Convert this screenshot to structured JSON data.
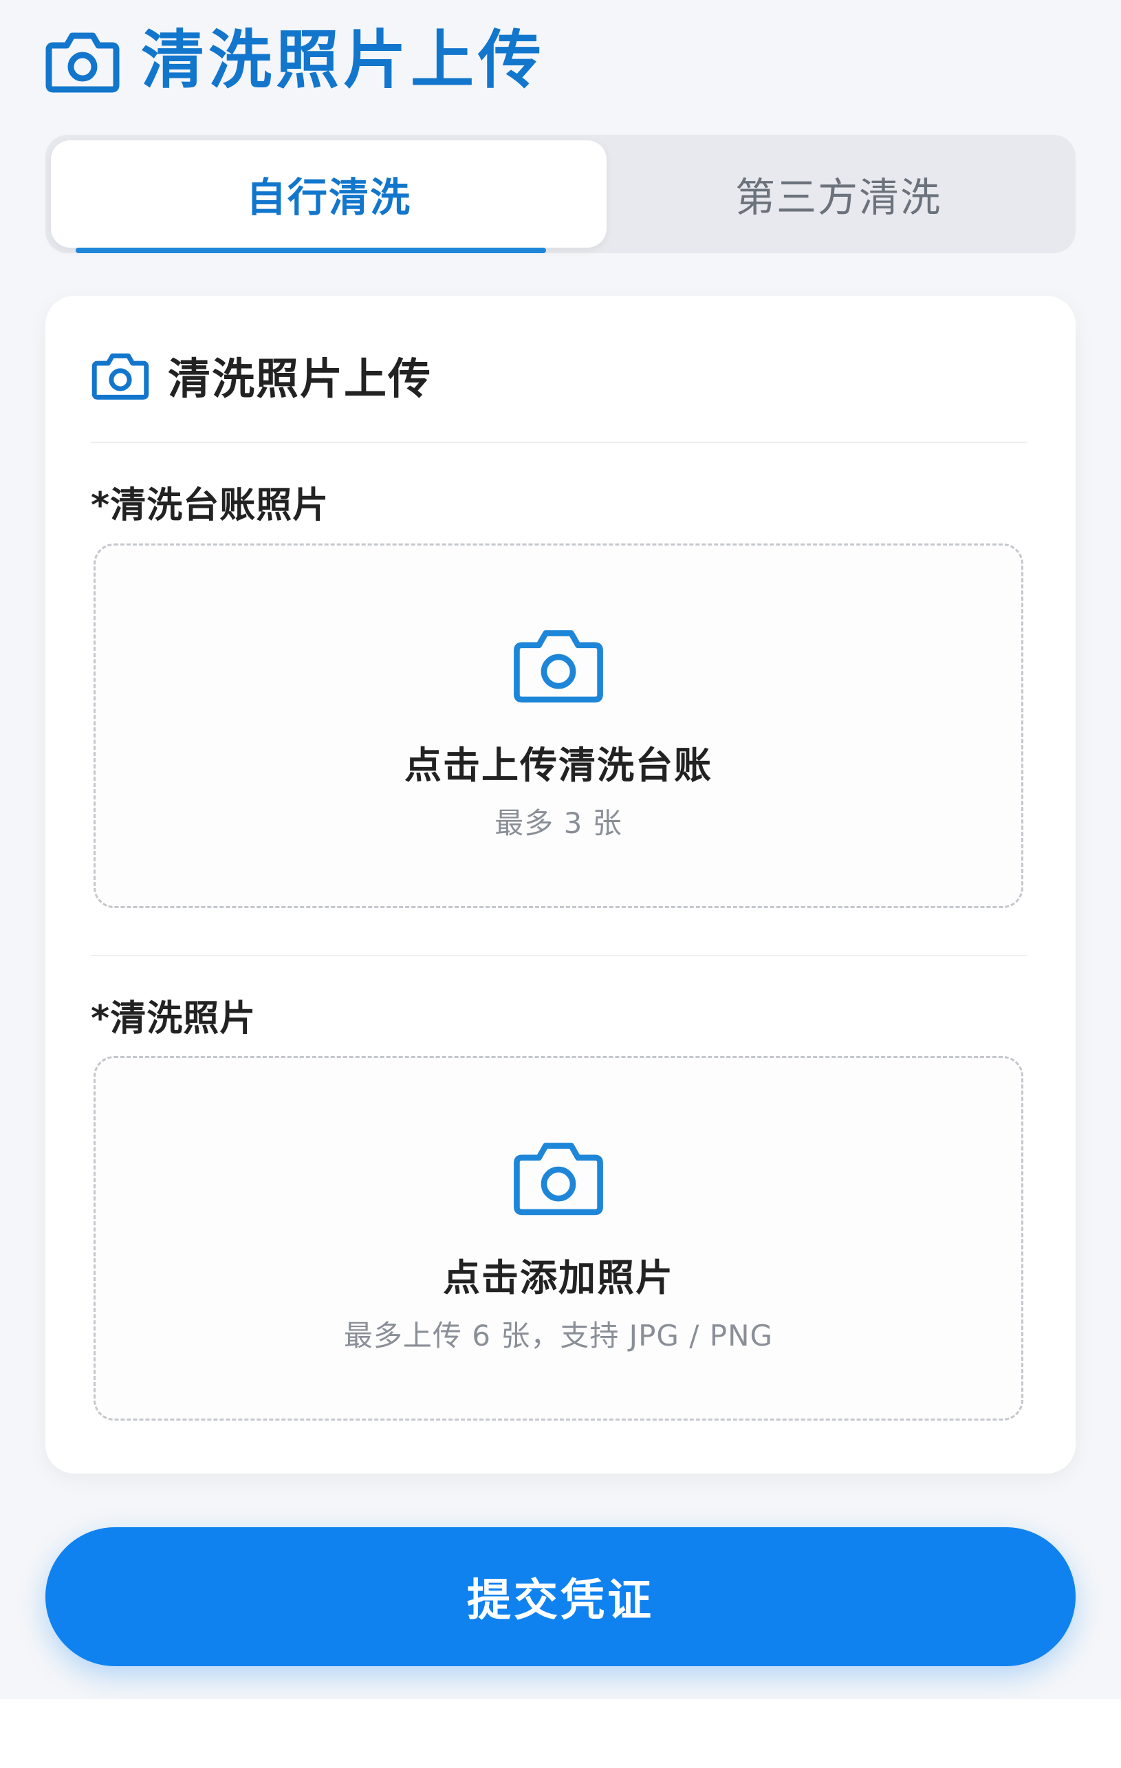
{
  "header": {
    "title": "清洗照片上传",
    "icon": "camera-icon",
    "color": "#1276cc"
  },
  "tabs": [
    {
      "label": "自行清洗",
      "active": true
    },
    {
      "label": "第三方清洗",
      "active": false
    }
  ],
  "card": {
    "title": "清洗照片上传",
    "icon": "camera-icon",
    "fields": [
      {
        "label": "*清洗台账照片",
        "upload_title": "点击上传清洗台账",
        "upload_hint": "最多 3 张",
        "icon": "camera-icon"
      },
      {
        "label": "*清洗照片",
        "upload_title": "点击添加照片",
        "upload_hint": "最多上传 6 张，支持 JPG / PNG",
        "icon": "camera-icon"
      }
    ]
  },
  "submit": {
    "label": "提交凭证",
    "color": "#0f82f0"
  }
}
